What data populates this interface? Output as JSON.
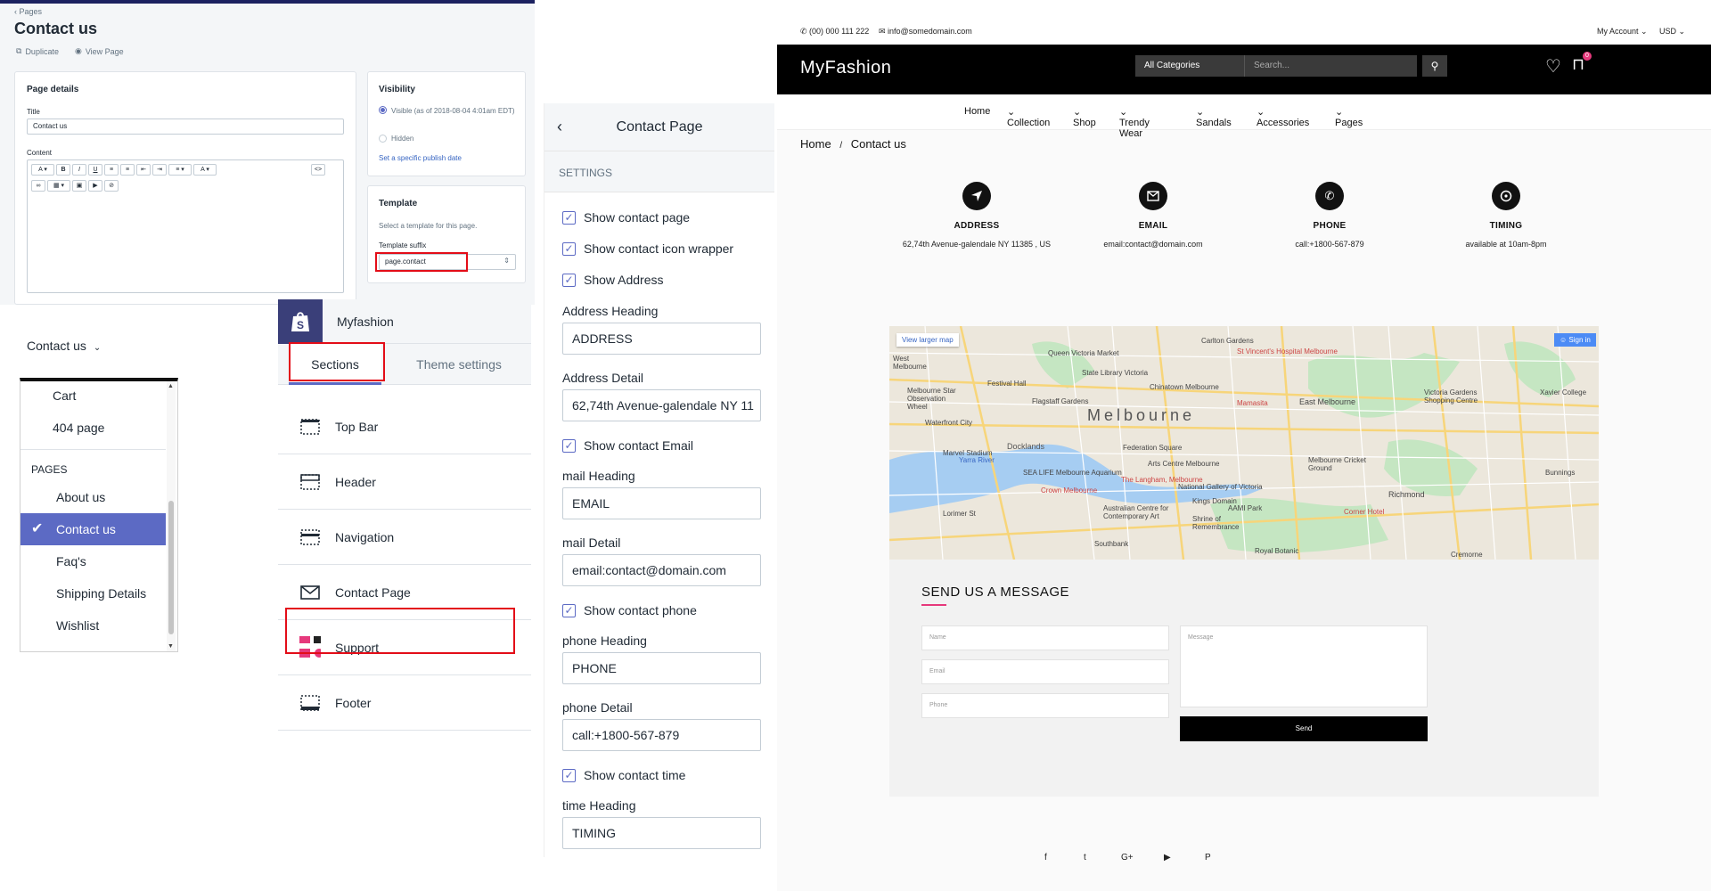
{
  "admin_page": {
    "breadcrumb": "Pages",
    "title": "Contact us",
    "duplicate": "Duplicate",
    "view_page": "View Page",
    "details_heading": "Page details",
    "title_label": "Title",
    "title_value": "Contact us",
    "content_label": "Content",
    "visibility_heading": "Visibility",
    "visible_label": "Visible (as of 2018-08-04 4:01am EDT)",
    "hidden_label": "Hidden",
    "publish_link": "Set a specific publish date",
    "template_heading": "Template",
    "template_help": "Select a template for this page.",
    "template_suffix_label": "Template suffix",
    "template_suffix_value": "page.contact"
  },
  "page_selector": {
    "current": "Contact us",
    "items": [
      {
        "label": "Cart"
      },
      {
        "label": "404 page"
      }
    ],
    "group_heading": "PAGES",
    "pages": [
      {
        "label": "About us"
      },
      {
        "label": "Contact us",
        "selected": true
      },
      {
        "label": "Faq's"
      },
      {
        "label": "Shipping Details"
      },
      {
        "label": "Wishlist"
      }
    ]
  },
  "theme_editor": {
    "store_name": "Myfashion",
    "tab_sections": "Sections",
    "tab_theme_settings": "Theme settings",
    "sections": [
      {
        "label": "Top Bar",
        "icon": "layout-icon"
      },
      {
        "label": "Header",
        "icon": "header-icon"
      },
      {
        "label": "Navigation",
        "icon": "layout-icon"
      },
      {
        "label": "Contact Page",
        "icon": "envelope-icon"
      },
      {
        "label": "Support",
        "icon": "support-image-icon"
      },
      {
        "label": "Footer",
        "icon": "layout-icon"
      }
    ]
  },
  "contact_settings": {
    "title": "Contact Page",
    "settings_label": "SETTINGS",
    "show_contact_page": "Show contact page",
    "show_icon_wrapper": "Show contact icon wrapper",
    "show_address": "Show Address",
    "address_heading_label": "Address Heading",
    "address_heading_value": "ADDRESS",
    "address_detail_label": "Address Detail",
    "address_detail_value": "62,74th Avenue-galendale NY 11",
    "show_email": "Show contact Email",
    "mail_heading_label": "mail Heading",
    "mail_heading_value": "EMAIL",
    "mail_detail_label": "mail Detail",
    "mail_detail_value": "email:contact@domain.com",
    "show_phone": "Show contact phone",
    "phone_heading_label": "phone Heading",
    "phone_heading_value": "PHONE",
    "phone_detail_label": "phone Detail",
    "phone_detail_value": "call:+1800-567-879",
    "show_time": "Show contact time",
    "time_heading_label": "time Heading",
    "time_heading_value": "TIMING"
  },
  "storefront": {
    "phone": "(00) 000 111 222",
    "email": "info@somedomain.com",
    "my_account": "My Account",
    "currency": "USD",
    "brand": "MyFashion",
    "category_select": "All Categories",
    "search_placeholder": "Search...",
    "cart_count": "0",
    "menu": [
      "Home",
      "Collection",
      "Shop",
      "Trendy Wear",
      "Sandals",
      "Accessories",
      "Pages"
    ],
    "breadcrumb_home": "Home",
    "breadcrumb_current": "Contact us",
    "contact_blocks": [
      {
        "heading": "ADDRESS",
        "detail": "62,74th Avenue-galendale NY 11385 , US",
        "icon": "location-arrow-icon"
      },
      {
        "heading": "EMAIL",
        "detail": "email:contact@domain.com",
        "icon": "envelope-icon"
      },
      {
        "heading": "PHONE",
        "detail": "call:+1800-567-879",
        "icon": "phone-icon"
      },
      {
        "heading": "TIMING",
        "detail": "available at 10am-8pm",
        "icon": "clock-icon"
      }
    ],
    "map_link": "View larger map",
    "map_city": "Melbourne",
    "map_signin": "Sign in",
    "map_labels": [
      "Carlton Gardens",
      "St Vincent's Hospital Melbourne",
      "Queen Victoria Market",
      "State Library Victoria",
      "Chinatown Melbourne",
      "Festival Hall",
      "Melbourne Star Observation Wheel",
      "Waterfront City",
      "Docklands",
      "Marvel Stadium",
      "Yarra River",
      "Flagstaff Gardens",
      "SEA LIFE Melbourne Aquarium",
      "Federation Square",
      "Arts Centre Melbourne",
      "Crown Melbourne",
      "National Gallery of Victoria",
      "The Langham, Melbourne",
      "Australian Centre for Contemporary Art",
      "Kings Domain",
      "AAMI Park",
      "Shrine of Remembrance",
      "Melbourne Cricket Ground",
      "East Melbourne",
      "Richmond",
      "Corner Hotel",
      "Victoria Gardens Shopping Centre",
      "Xavier College",
      "Bunnings",
      "Southbank",
      "Royal Botanic",
      "Mamasita",
      "Lorimer St",
      "West Melbourne",
      "Cremorne"
    ],
    "form_heading": "SEND US A MESSAGE",
    "name_placeholder": "Name",
    "email_placeholder": "Email",
    "phone_placeholder": "Phone",
    "message_placeholder": "Message",
    "send_label": "Send",
    "social": [
      {
        "icon": "facebook-icon",
        "glyph": "f"
      },
      {
        "icon": "twitter-icon",
        "glyph": "t"
      },
      {
        "icon": "google-plus-icon",
        "glyph": "G+"
      },
      {
        "icon": "youtube-icon",
        "glyph": "▶"
      },
      {
        "icon": "pinterest-icon",
        "glyph": "P"
      }
    ]
  }
}
